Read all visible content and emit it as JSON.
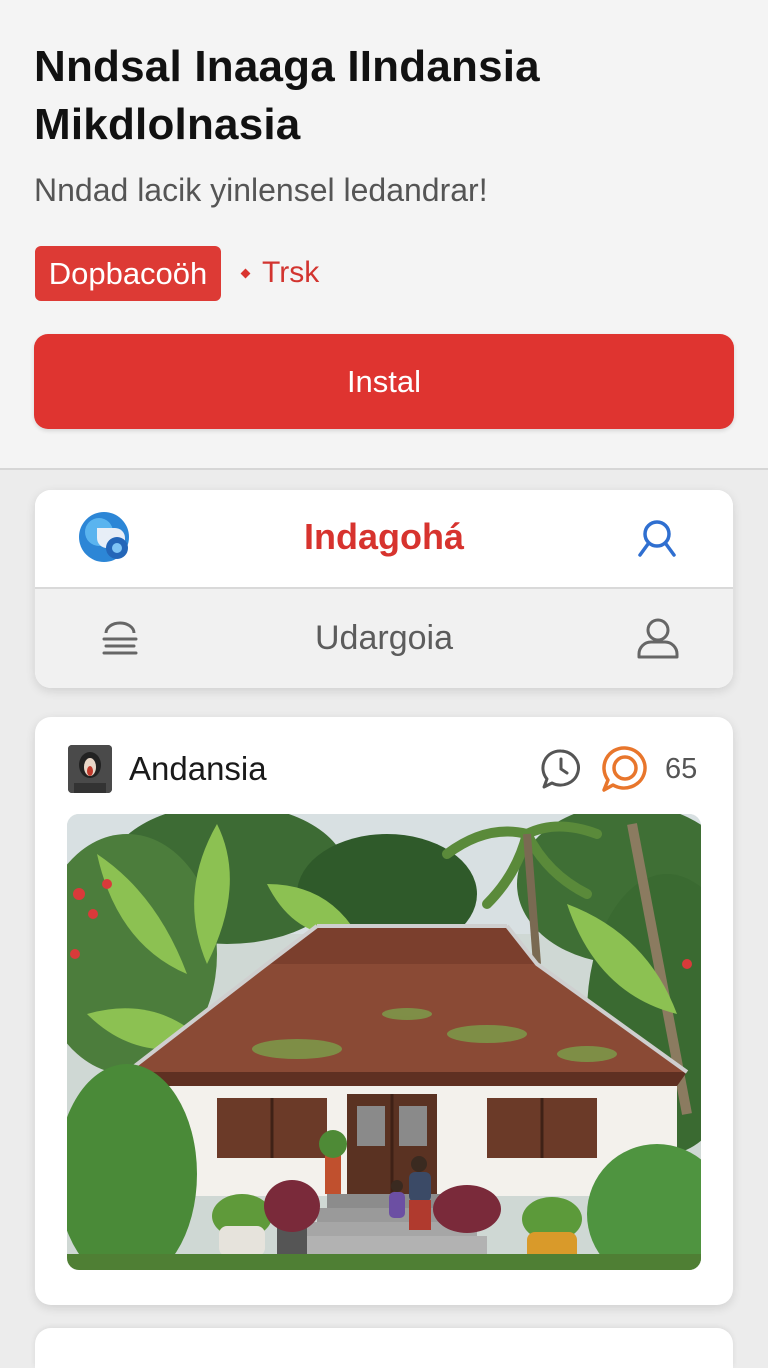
{
  "app": {
    "title": "Nndsal Inaaga IIndansia Mikdlolnasia",
    "subtitle": "Nndad lacik yinlensel ledandrar!",
    "badge": "Dopbacoöh",
    "badge_meta": "Trsk",
    "install_label": "Instal"
  },
  "nav": {
    "brand": "Indagohá",
    "subtitle": "Udargoia",
    "icons": {
      "logo": "app-logo-icon",
      "search": "search-icon",
      "menu": "menu-icon",
      "profile": "profile-icon"
    }
  },
  "post": {
    "author": "Andansia",
    "reaction_count": "65",
    "icons": {
      "comment": "comment-icon",
      "reaction": "reaction-icon"
    },
    "photo_description_alt": "Traditional house with tiled roof among banana and palm trees"
  },
  "colors": {
    "accent_red": "#df3430",
    "link_blue": "#2f6fd0",
    "reaction_orange": "#e8762c"
  }
}
